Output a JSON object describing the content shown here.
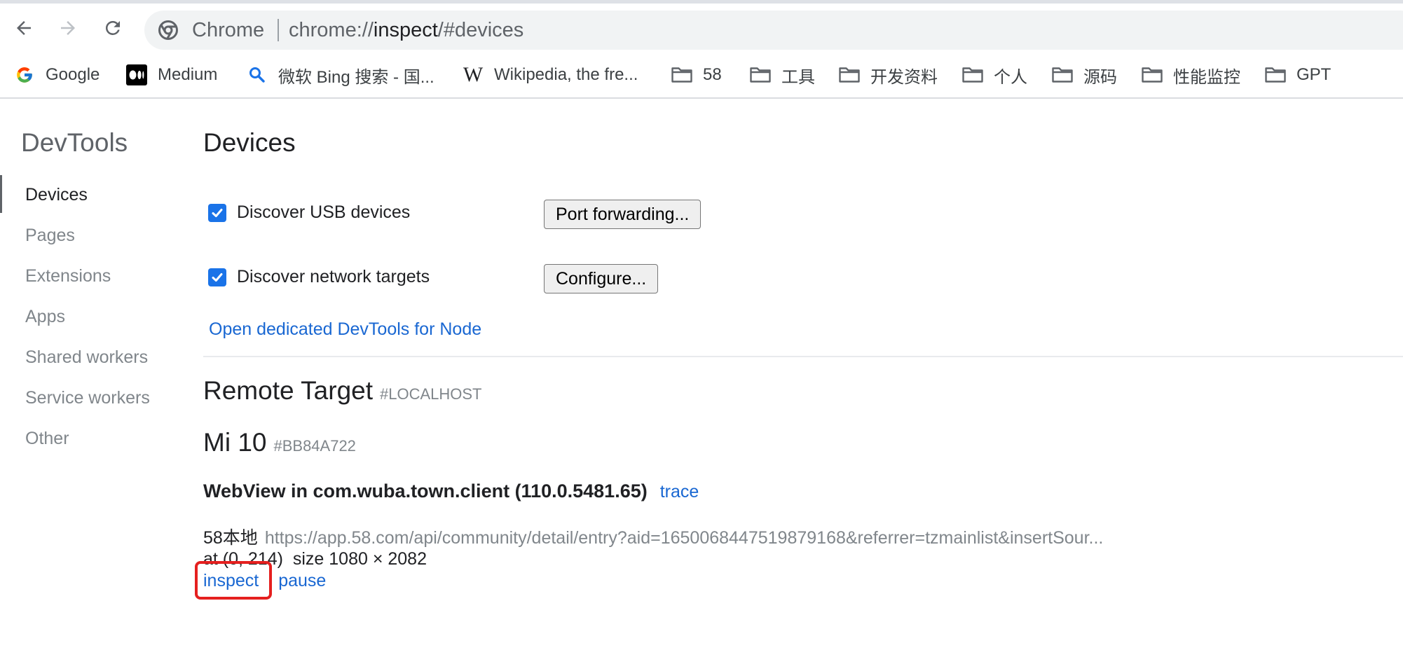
{
  "browser": {
    "chip_label": "Chrome",
    "url_scheme": "chrome://",
    "url_host": "inspect",
    "url_path": "/#devices",
    "colors": {
      "accent": "#1a73e8",
      "link": "#1967d2",
      "highlight": "#e5201f"
    }
  },
  "bookmarks": [
    {
      "label": "Google",
      "icon": "google-icon"
    },
    {
      "label": "Medium",
      "icon": "medium-icon"
    },
    {
      "label": "微软 Bing 搜索 - 国...",
      "icon": "bing-search-icon"
    },
    {
      "label": "Wikipedia, the fre...",
      "icon": "wikipedia-icon"
    },
    {
      "label": "58",
      "icon": "folder-icon"
    },
    {
      "label": "工具",
      "icon": "folder-icon"
    },
    {
      "label": "开发资料",
      "icon": "folder-icon"
    },
    {
      "label": "个人",
      "icon": "folder-icon"
    },
    {
      "label": "源码",
      "icon": "folder-icon"
    },
    {
      "label": "性能监控",
      "icon": "folder-icon"
    },
    {
      "label": "GPT",
      "icon": "folder-icon"
    }
  ],
  "sidebar": {
    "title": "DevTools",
    "items": [
      {
        "label": "Devices",
        "active": true
      },
      {
        "label": "Pages"
      },
      {
        "label": "Extensions"
      },
      {
        "label": "Apps"
      },
      {
        "label": "Shared workers"
      },
      {
        "label": "Service workers"
      },
      {
        "label": "Other"
      }
    ]
  },
  "main": {
    "title": "Devices",
    "discover_usb": {
      "label": "Discover USB devices",
      "checked": true,
      "button": "Port forwarding..."
    },
    "discover_network": {
      "label": "Discover network targets",
      "checked": true,
      "button": "Configure..."
    },
    "node_link": "Open dedicated DevTools for Node",
    "remote_target": {
      "title": "Remote Target",
      "subtitle": "#LOCALHOST"
    },
    "device": {
      "name": "Mi 10",
      "serial": "#BB84A722"
    },
    "webview": {
      "title": "WebView in com.wuba.town.client (110.0.5481.65)",
      "trace_link": "trace"
    },
    "target": {
      "name": "58本地",
      "url": "https://app.58.com/api/community/detail/entry?aid=1650068447519879168&referrer=tzmainlist&insertSour...",
      "position": "at (0, 214)",
      "size": "size 1080 × 2082",
      "inspect_link": "inspect",
      "pause_link": "pause"
    }
  }
}
